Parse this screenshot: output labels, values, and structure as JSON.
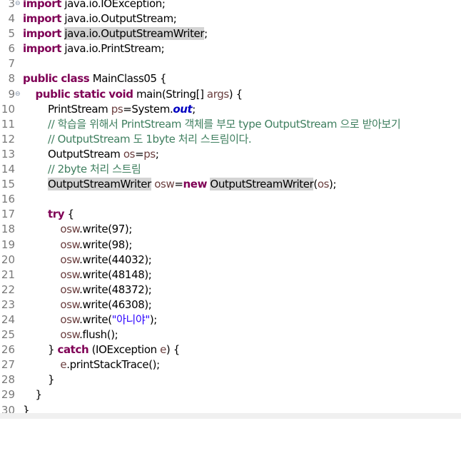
{
  "editor": {
    "lines": {
      "l3": {
        "num": "3",
        "fold": "⊖",
        "t": [
          "import",
          " java.io.IOException;"
        ]
      },
      "l4": {
        "num": "4",
        "t": [
          "import",
          " java.io.OutputStream;"
        ]
      },
      "l5": {
        "num": "5",
        "t": [
          "import",
          " ",
          "java.io.OutputStreamWriter",
          ";"
        ]
      },
      "l6": {
        "num": "6",
        "t": [
          "import",
          " java.io.PrintStream;"
        ]
      },
      "l7": {
        "num": "7"
      },
      "l8": {
        "num": "8",
        "t": [
          "public",
          " ",
          "class",
          " MainClass05 {"
        ]
      },
      "l9": {
        "num": "9",
        "fold": "⊖",
        "t": [
          "    ",
          "public",
          " ",
          "static",
          " ",
          "void",
          " main(String[] ",
          "args",
          ") {"
        ]
      },
      "l10": {
        "num": "10",
        "t": [
          "        PrintStream ",
          "ps",
          "=System.",
          "out",
          ";"
        ]
      },
      "l11": {
        "num": "11",
        "t": [
          "        ",
          "// 학습을 위해서 PrintStream 객체를 부모 type OutputStream 으로 받아보기"
        ]
      },
      "l12": {
        "num": "12",
        "t": [
          "        ",
          "// OutputStream 도 1byte 처리 스트림이다."
        ]
      },
      "l13": {
        "num": "13",
        "t": [
          "        OutputStream ",
          "os",
          "=",
          "ps",
          ";"
        ]
      },
      "l14": {
        "num": "14",
        "t": [
          "        ",
          "// 2byte 처리 스트림"
        ]
      },
      "l15": {
        "num": "15",
        "t": [
          "        ",
          "OutputStreamWriter",
          " ",
          "osw",
          "=",
          "new",
          " ",
          "OutputStreamWriter",
          "(",
          "os",
          ");"
        ]
      },
      "l16": {
        "num": "16"
      },
      "l17": {
        "num": "17",
        "t": [
          "        ",
          "try",
          " {"
        ]
      },
      "l18": {
        "num": "18",
        "t": [
          "            ",
          "osw",
          ".write(97);"
        ]
      },
      "l19": {
        "num": "19",
        "t": [
          "            ",
          "osw",
          ".write(98);"
        ]
      },
      "l20": {
        "num": "20",
        "t": [
          "            ",
          "osw",
          ".write(44032);"
        ]
      },
      "l21": {
        "num": "21",
        "t": [
          "            ",
          "osw",
          ".write(48148);"
        ]
      },
      "l22": {
        "num": "22",
        "t": [
          "            ",
          "osw",
          ".write(48372);"
        ]
      },
      "l23": {
        "num": "23",
        "t": [
          "            ",
          "osw",
          ".write(46308);"
        ]
      },
      "l24": {
        "num": "24",
        "t": [
          "            ",
          "osw",
          ".write(",
          "\"아니야\"",
          ");"
        ]
      },
      "l25": {
        "num": "25",
        "t": [
          "            ",
          "osw",
          ".flush();"
        ]
      },
      "l26": {
        "num": "26",
        "t": [
          "        } ",
          "catch",
          " (IOException ",
          "e",
          ") {"
        ]
      },
      "l27": {
        "num": "27",
        "t": [
          "            ",
          "e",
          ".printStackTrace();"
        ]
      },
      "l28": {
        "num": "28",
        "t": [
          "        }"
        ]
      },
      "l29": {
        "num": "29",
        "t": [
          "    }"
        ]
      },
      "l30": {
        "num": "30",
        "t": [
          "}"
        ]
      }
    }
  }
}
